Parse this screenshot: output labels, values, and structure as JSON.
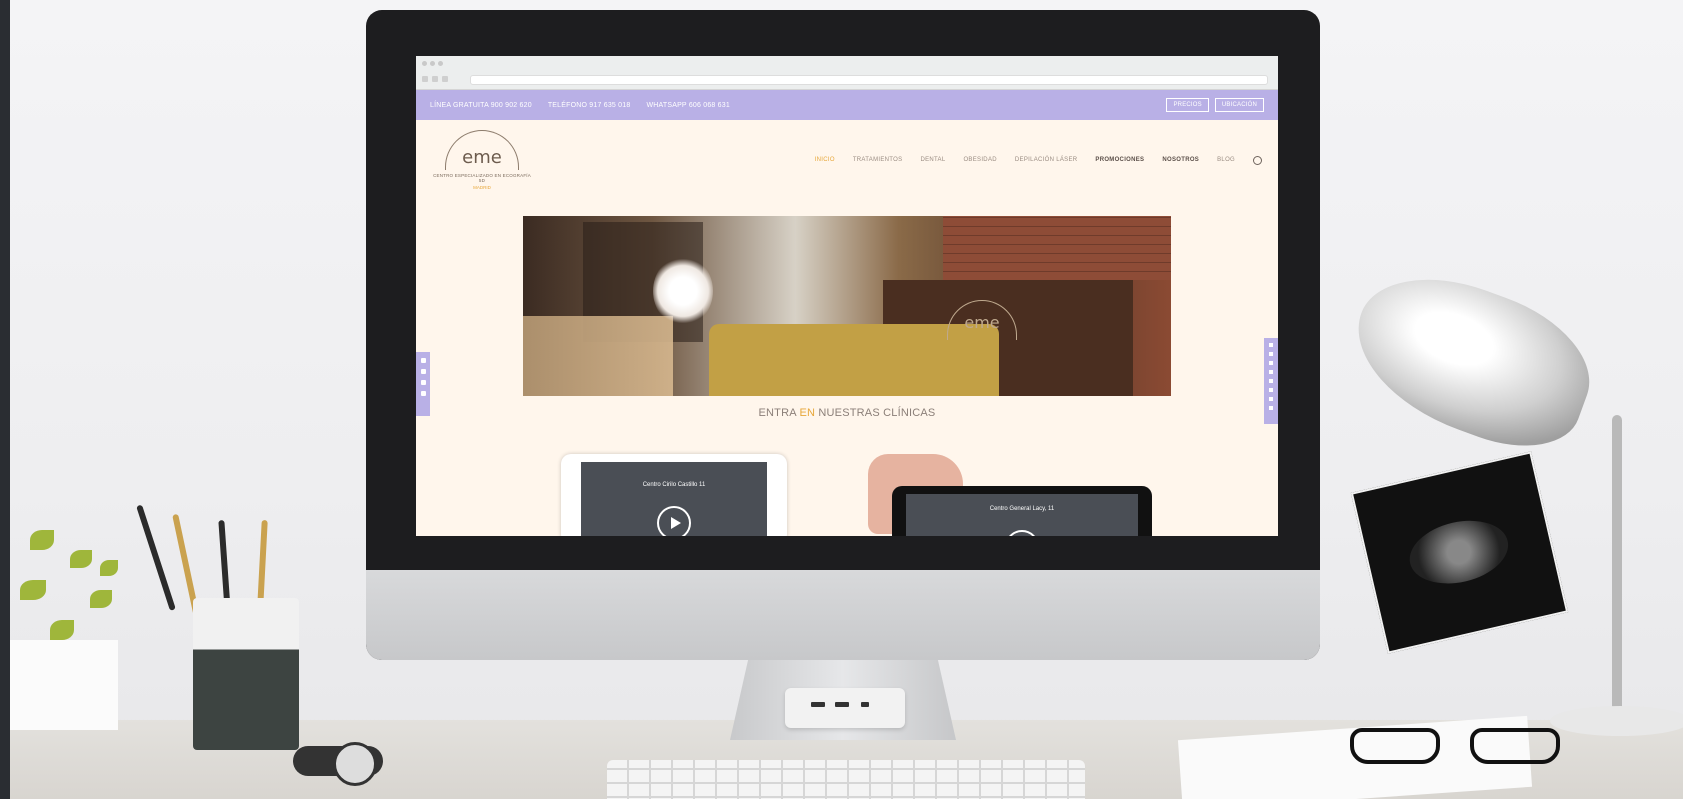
{
  "site": {
    "topbar": {
      "phone1": "LÍNEA GRATUITA 900 902 620",
      "phone2": "TELÉFONO 917 635 018",
      "phone3": "WHATSAPP 606 068 631",
      "btn_precios": "PRECIOS",
      "btn_ubicacion": "UBICACIÓN"
    },
    "logo": {
      "mark": "eme",
      "subtitle": "CENTRO ESPECIALIZADO EN ECOGRAFÍA 5D",
      "location": "MADRID"
    },
    "menu": [
      {
        "label": "INICIO",
        "style": "active"
      },
      {
        "label": "TRATAMIENTOS",
        "style": "normal"
      },
      {
        "label": "DENTAL",
        "style": "normal"
      },
      {
        "label": "OBESIDAD",
        "style": "normal"
      },
      {
        "label": "DEPILACIÓN LÁSER",
        "style": "normal"
      },
      {
        "label": "PROMOCIONES",
        "style": "bold"
      },
      {
        "label": "NOSOTROS",
        "style": "bold"
      },
      {
        "label": "BLOG",
        "style": "normal"
      }
    ],
    "hero_logo": "eme",
    "section_title_prefix": "ENTRA ",
    "section_title_highlight": "EN",
    "section_title_suffix": " NUESTRAS CLÍNICAS",
    "video1_caption": "Centro Cirilo Castillo 11",
    "video2_caption": "Centro General Lacy, 11"
  },
  "colors": {
    "accent": "#b9b0e6",
    "highlight": "#e7a73a",
    "page_bg": "#fff6ec"
  }
}
